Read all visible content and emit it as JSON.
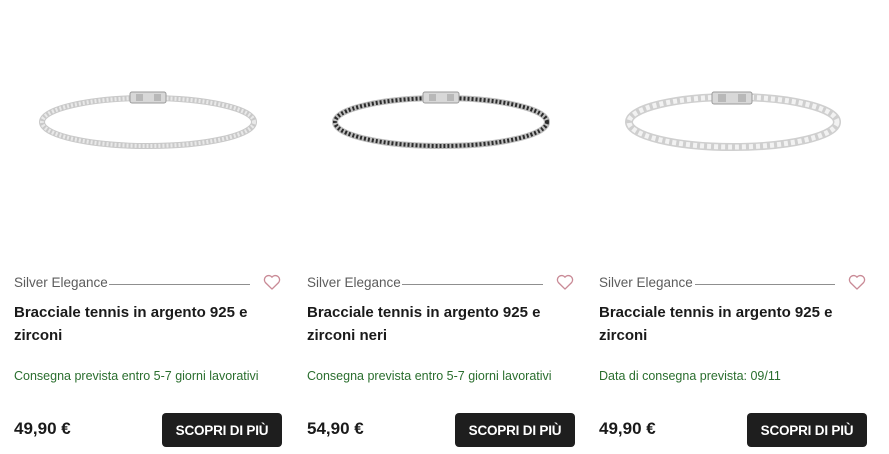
{
  "products": [
    {
      "brand": "Silver Elegance",
      "title": "Bracciale tennis in argento 925 e zirconi",
      "delivery": "Consegna prevista entro 5-7 giorni lavorativi",
      "price": "49,90 €",
      "cta": "SCOPRI DI PIÙ",
      "stone_color": "#e9e9e9"
    },
    {
      "brand": "Silver Elegance",
      "title": "Bracciale tennis in argento 925 e zirconi neri",
      "delivery": "Consegna prevista entro 5-7 giorni lavorativi",
      "price": "54,90 €",
      "cta": "SCOPRI DI PIÙ",
      "stone_color": "#2b2b2b"
    },
    {
      "brand": "Silver Elegance",
      "title": "Bracciale tennis in argento 925 e zirconi",
      "delivery": "Data di consegna prevista: 09/11",
      "price": "49,90 €",
      "cta": "SCOPRI DI PIÙ",
      "stone_color": "#f2f2f2"
    }
  ],
  "colors": {
    "heart": "#c98a96",
    "delivery_text": "#2a6e2e",
    "button_bg": "#1e1e1e"
  }
}
